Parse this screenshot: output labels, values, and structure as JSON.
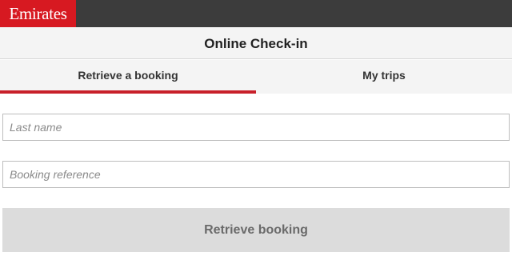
{
  "brand": {
    "logo_text": "Emirates",
    "accent_color": "#d71921"
  },
  "header": {
    "title": "Online Check-in"
  },
  "tabs": [
    {
      "label": "Retrieve a booking",
      "active": true
    },
    {
      "label": "My trips",
      "active": false
    }
  ],
  "form": {
    "last_name": {
      "value": "",
      "placeholder": "Last name"
    },
    "booking_reference": {
      "value": "",
      "placeholder": "Booking reference"
    },
    "submit_label": "Retrieve booking"
  },
  "colors": {
    "topbar": "#3c3c3c",
    "active_tab_underline": "#c8202a",
    "button_disabled_bg": "#dcdcdc"
  }
}
